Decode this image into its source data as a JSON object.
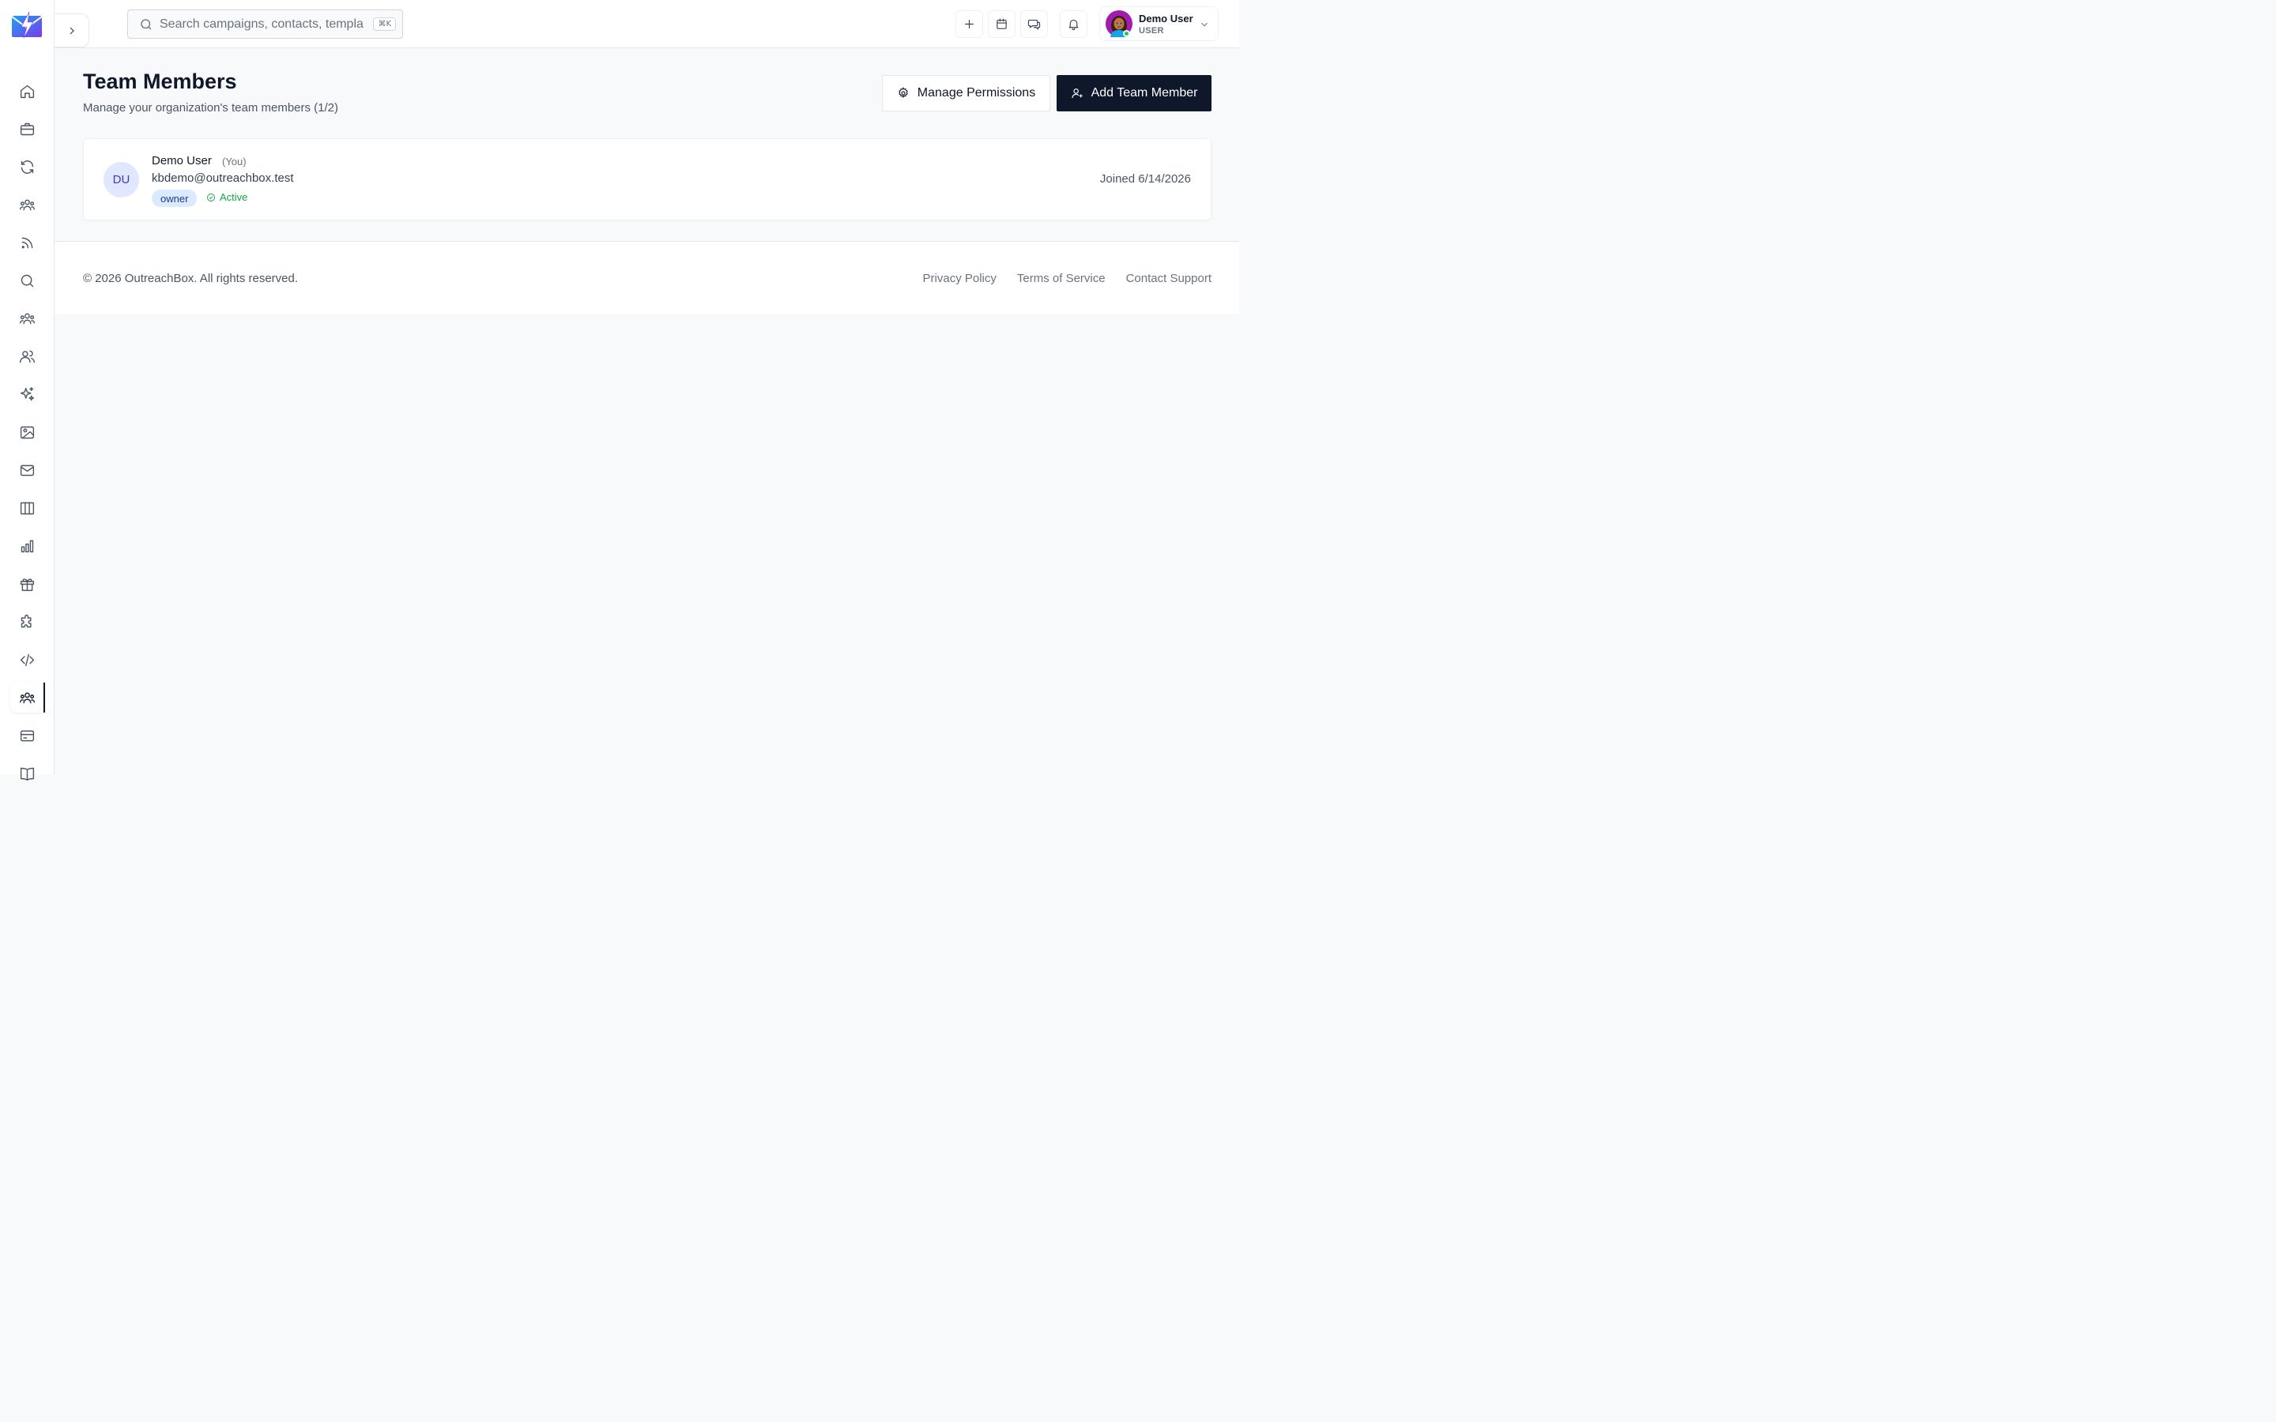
{
  "app": {
    "name": "OutreachBox"
  },
  "search": {
    "placeholder": "Search campaigns, contacts, templa",
    "shortcut": "⌘K"
  },
  "user_menu": {
    "name": "Demo User",
    "role": "USER"
  },
  "page": {
    "title": "Team Members",
    "subtitle": "Manage your organization's team members (1/2)"
  },
  "actions": {
    "manage_permissions": "Manage Permissions",
    "add_member": "Add Team Member"
  },
  "members": [
    {
      "initials": "DU",
      "name": "Demo User",
      "you_tag": "(You)",
      "email": "kbdemo@outreachbox.test",
      "role": "owner",
      "status": "Active",
      "joined": "Joined 6/14/2026"
    }
  ],
  "footer": {
    "copyright": "© 2026 OutreachBox. All rights reserved.",
    "links": [
      "Privacy Policy",
      "Terms of Service",
      "Contact Support"
    ]
  },
  "colors": {
    "primary": "#0f172a",
    "accent": "#4338ca",
    "success": "#16a34a"
  }
}
